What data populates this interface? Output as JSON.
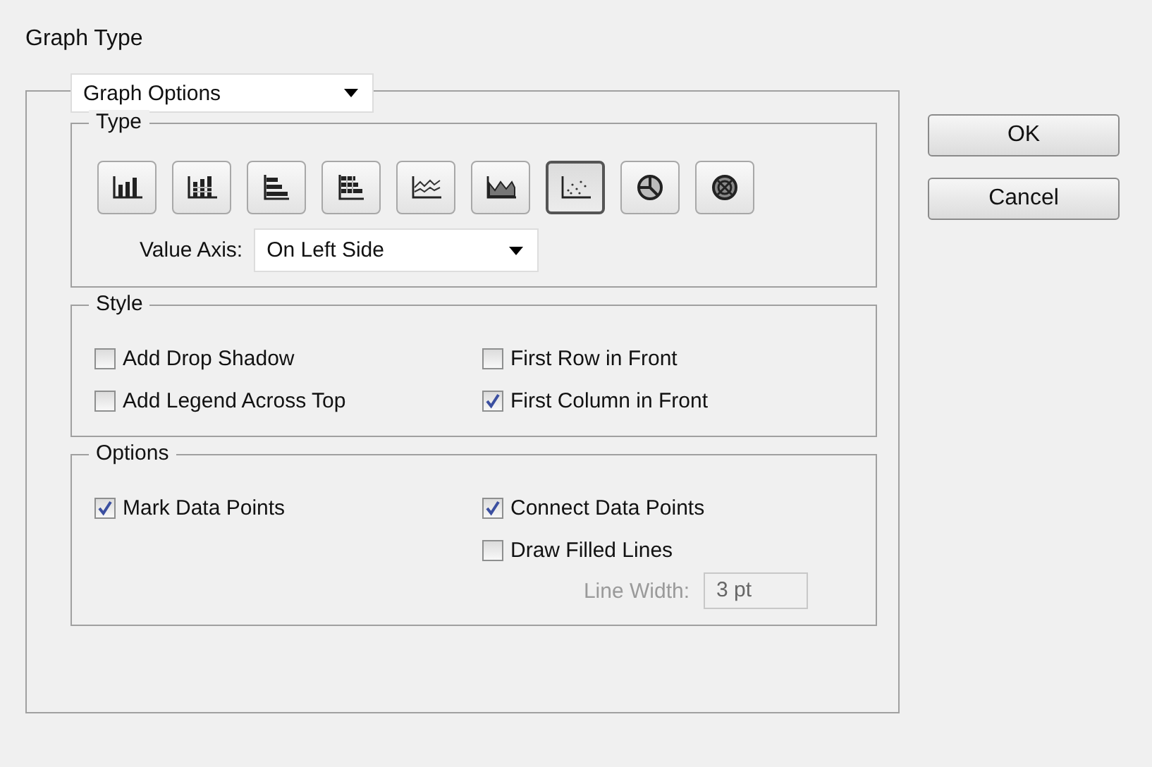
{
  "window": {
    "title": "Graph Type"
  },
  "section_select": {
    "value": "Graph Options"
  },
  "type_group": {
    "title": "Type",
    "types": [
      {
        "kind": "column",
        "selected": false
      },
      {
        "kind": "stacked-column",
        "selected": false
      },
      {
        "kind": "bar",
        "selected": false
      },
      {
        "kind": "stacked-bar",
        "selected": false
      },
      {
        "kind": "line",
        "selected": false
      },
      {
        "kind": "area",
        "selected": false
      },
      {
        "kind": "scatter",
        "selected": true
      },
      {
        "kind": "pie",
        "selected": false
      },
      {
        "kind": "radar",
        "selected": false
      }
    ],
    "value_axis": {
      "label": "Value Axis:",
      "value": "On Left Side"
    }
  },
  "style_group": {
    "title": "Style",
    "checkboxes": [
      {
        "label": "Add Drop Shadow",
        "checked": false
      },
      {
        "label": "First Row in Front",
        "checked": false
      },
      {
        "label": "Add Legend Across Top",
        "checked": false
      },
      {
        "label": "First Column in Front",
        "checked": true
      }
    ]
  },
  "options_group": {
    "title": "Options",
    "checkboxes": [
      {
        "label": "Mark Data Points",
        "checked": true
      },
      {
        "label": "Connect Data Points",
        "checked": true
      },
      {
        "label": "Draw Filled Lines",
        "checked": false
      }
    ],
    "line_width": {
      "label": "Line Width:",
      "value": "3 pt",
      "disabled": true
    }
  },
  "buttons": [
    "OK",
    "Cancel"
  ]
}
